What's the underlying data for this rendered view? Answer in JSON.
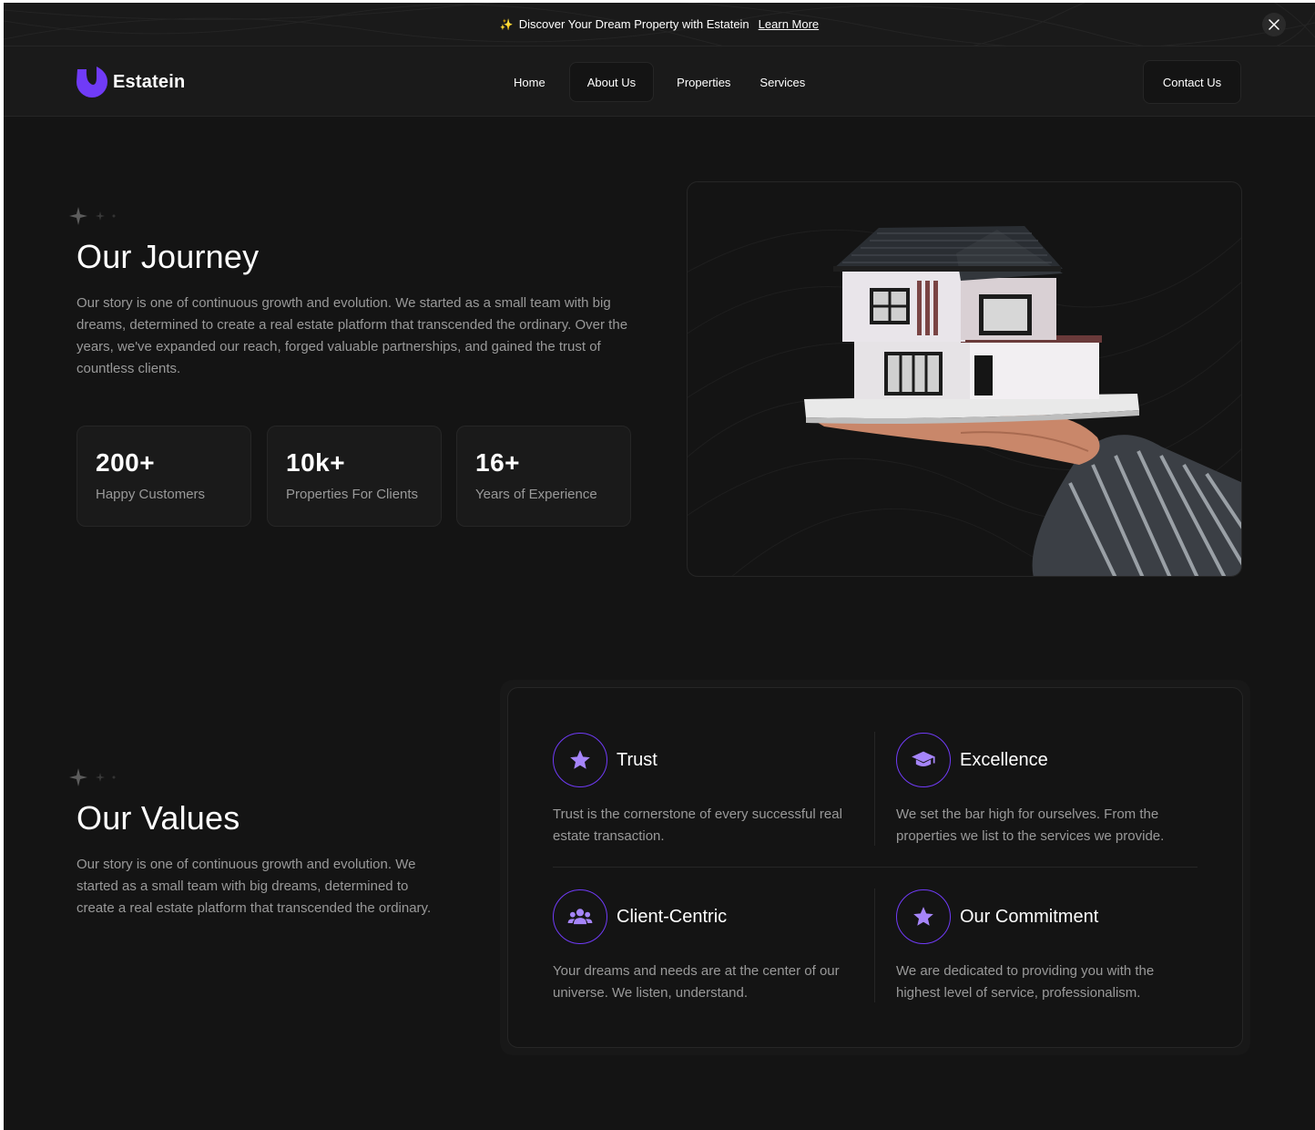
{
  "banner": {
    "text": "Discover Your Dream Property with Estatein",
    "link": "Learn More"
  },
  "header": {
    "brand": "Estatein",
    "nav": [
      {
        "label": "Home",
        "active": false
      },
      {
        "label": "About Us",
        "active": true
      },
      {
        "label": "Properties",
        "active": false
      },
      {
        "label": "Services",
        "active": false
      }
    ],
    "contact": "Contact Us"
  },
  "journey": {
    "title": "Our Journey",
    "paragraph": "Our story is one of continuous growth and evolution. We started as a small team with big dreams, determined to create a real estate platform that transcended the ordinary. Over the years, we've expanded our reach, forged valuable partnerships, and gained the trust of countless clients.",
    "stats": [
      {
        "value": "200+",
        "label": "Happy Customers"
      },
      {
        "value": "10k+",
        "label": "Properties For Clients"
      },
      {
        "value": "16+",
        "label": "Years of Experience"
      }
    ]
  },
  "values": {
    "title": "Our Values",
    "paragraph": "Our story is one of continuous growth and evolution. We started as a small team with big dreams, determined to create a real estate platform that transcended the ordinary.",
    "items": [
      {
        "title": "Trust",
        "text": "Trust is the cornerstone of every successful real estate transaction.",
        "icon": "star-icon"
      },
      {
        "title": "Excellence",
        "text": "We set the bar high for ourselves. From the properties we list to the services we provide.",
        "icon": "graduation-cap-icon"
      },
      {
        "title": "Client-Centric",
        "text": "Your dreams and needs are at the center of our universe. We listen, understand.",
        "icon": "users-icon"
      },
      {
        "title": "Our Commitment",
        "text": "We are dedicated to providing you with the highest level of service, professionalism.",
        "icon": "star-icon"
      }
    ]
  },
  "colors": {
    "accent": "#703bf7",
    "icon_fill": "#a685fa",
    "background": "#141414",
    "card": "#1a1a1a",
    "border": "#262626",
    "muted_text": "#999999"
  }
}
